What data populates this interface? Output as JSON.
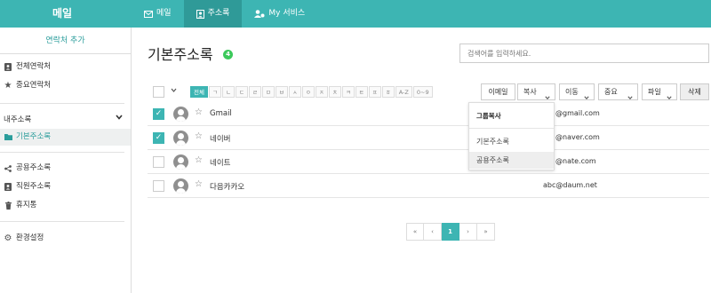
{
  "app": {
    "brand": "메일"
  },
  "nav": [
    {
      "label": "메일",
      "icon": "mail-icon"
    },
    {
      "label": "주소록",
      "icon": "contacts-icon"
    },
    {
      "label": "My 서비스",
      "icon": "user-icon"
    }
  ],
  "sidebar": {
    "add_contact": "연락처 추가",
    "all_contacts": "전체연락처",
    "important_contacts": "중요연락처",
    "my_group_title": "내주소록",
    "basic_address_book": "기본주소록",
    "shared_address_book": "공용주소록",
    "staff_address_book": "직원주소록",
    "trash": "휴지통",
    "settings": "환경설정"
  },
  "main": {
    "title": "기본주소록",
    "count": "4",
    "search_placeholder": "검색어를 입력하세요."
  },
  "filters": [
    "전체",
    "ㄱ",
    "ㄴ",
    "ㄷ",
    "ㄹ",
    "ㅁ",
    "ㅂ",
    "ㅅ",
    "ㅇ",
    "ㅈ",
    "ㅊ",
    "ㅋ",
    "ㅌ",
    "ㅍ",
    "ㅎ",
    "A-Z",
    "0~9"
  ],
  "toolbar": {
    "email": "이메일",
    "copy": "복사",
    "move": "이동",
    "important": "중요",
    "file": "파일",
    "delete": "삭제"
  },
  "contacts": [
    {
      "name": "Gmail",
      "email": "@gmail.com",
      "checked": true
    },
    {
      "name": "네이버",
      "email": "@naver.com",
      "checked": true
    },
    {
      "name": "네이트",
      "email": "@nate.com",
      "checked": false
    },
    {
      "name": "다음카카오",
      "email": "abc@daum.net",
      "checked": false
    }
  ],
  "copy_dropdown": {
    "title": "그룹복사",
    "items": [
      "기본주소록",
      "공용주소록"
    ]
  },
  "pagination": {
    "first": "«",
    "prev": "‹",
    "current": "1",
    "next": "›",
    "last": "»"
  },
  "colors": {
    "accent": "#3db5b3",
    "badge": "#3cc95b"
  }
}
